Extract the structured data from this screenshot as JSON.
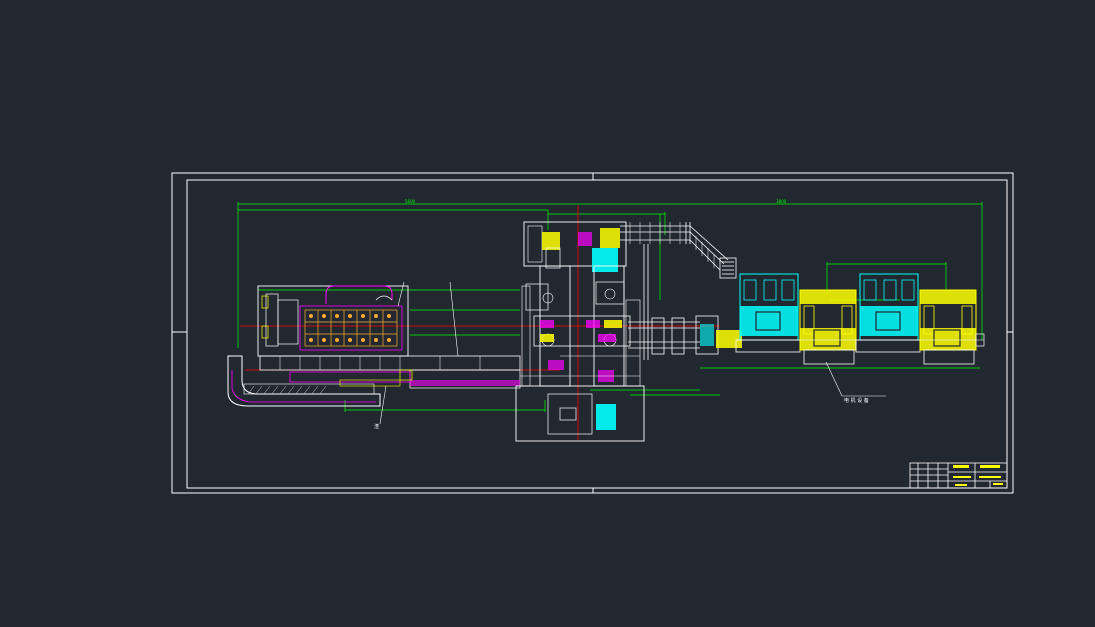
{
  "drawing": {
    "background": "#212830",
    "colors": {
      "frame": "#ffffff",
      "dimension": "#00ff00",
      "centerline": "#ff0000",
      "magenta": "#ff00ff",
      "cyan": "#00ffff",
      "yellow": "#ffff00",
      "outline": "#ffffff"
    },
    "annotations": {
      "callout_right": "电 机 设 备",
      "callout_bottom": "渣",
      "dim_top": "5600",
      "dim_top2": "3800"
    }
  }
}
